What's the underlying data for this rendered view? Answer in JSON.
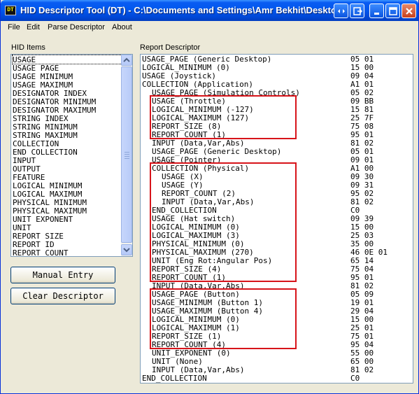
{
  "window": {
    "title": "HID Descriptor Tool (DT) - C:\\Documents and Settings\\Amr Bekhit\\Desktop",
    "icon_text": "DT"
  },
  "title_buttons": [
    "restore-icon",
    "extra-icon",
    "minimize-icon",
    "maximize-icon",
    "close-icon"
  ],
  "menu": [
    "File",
    "Edit",
    "Parse Descriptor",
    "About"
  ],
  "hid_items": {
    "label": "HID Items",
    "items": [
      "USAGE",
      "USAGE_PAGE",
      "USAGE_MINIMUM",
      "USAGE_MAXIMUM",
      "DESIGNATOR_INDEX",
      "DESIGNATOR_MINIMUM",
      "DESIGNATOR_MAXIMUM",
      "STRING_INDEX",
      "STRING_MINIMUM",
      "STRING_MAXIMUM",
      "COLLECTION",
      "END_COLLECTION",
      "INPUT",
      "OUTPUT",
      "FEATURE",
      "LOGICAL_MINIMUM",
      "LOGICAL_MAXIMUM",
      "PHYSICAL_MINIMUM",
      "PHYSICAL_MAXIMUM",
      "UNIT_EXPONENT",
      "UNIT",
      "REPORT_SIZE",
      "REPORT_ID",
      "REPORT_COUNT"
    ],
    "selected_index": 0
  },
  "buttons": {
    "manual_entry": "Manual Entry",
    "clear_descriptor": "Clear Descriptor"
  },
  "report": {
    "label": "Report Descriptor",
    "lines": [
      {
        "text": "USAGE_PAGE (Generic Desktop)",
        "indent": 0,
        "bytes": "05 01"
      },
      {
        "text": "LOGICAL_MINIMUM (0)",
        "indent": 0,
        "bytes": "15 00"
      },
      {
        "text": "USAGE (Joystick)",
        "indent": 0,
        "bytes": "09 04"
      },
      {
        "text": "COLLECTION (Application)",
        "indent": 0,
        "bytes": "A1 01"
      },
      {
        "text": "USAGE_PAGE (Simulation Controls)",
        "indent": 1,
        "bytes": "05 02"
      },
      {
        "text": "USAGE (Throttle)",
        "indent": 1,
        "bytes": "09 BB"
      },
      {
        "text": "LOGICAL_MINIMUM (-127)",
        "indent": 1,
        "bytes": "15 81"
      },
      {
        "text": "LOGICAL_MAXIMUM (127)",
        "indent": 1,
        "bytes": "25 7F"
      },
      {
        "text": "REPORT_SIZE (8)",
        "indent": 1,
        "bytes": "75 08"
      },
      {
        "text": "REPORT_COUNT (1)",
        "indent": 1,
        "bytes": "95 01"
      },
      {
        "text": "INPUT (Data,Var,Abs)",
        "indent": 1,
        "bytes": "81 02"
      },
      {
        "text": "USAGE_PAGE (Generic Desktop)",
        "indent": 1,
        "bytes": "05 01"
      },
      {
        "text": "USAGE (Pointer)",
        "indent": 1,
        "bytes": "09 01"
      },
      {
        "text": "COLLECTION (Physical)",
        "indent": 1,
        "bytes": "A1 00"
      },
      {
        "text": "USAGE (X)",
        "indent": 2,
        "bytes": "09 30"
      },
      {
        "text": "USAGE (Y)",
        "indent": 2,
        "bytes": "09 31"
      },
      {
        "text": "REPORT_COUNT (2)",
        "indent": 2,
        "bytes": "95 02"
      },
      {
        "text": "INPUT (Data,Var,Abs)",
        "indent": 2,
        "bytes": "81 02"
      },
      {
        "text": "END_COLLECTION",
        "indent": 1,
        "bytes": "C0"
      },
      {
        "text": "USAGE (Hat switch)",
        "indent": 1,
        "bytes": "09 39"
      },
      {
        "text": "LOGICAL_MINIMUM (0)",
        "indent": 1,
        "bytes": "15 00"
      },
      {
        "text": "LOGICAL_MAXIMUM (3)",
        "indent": 1,
        "bytes": "25 03"
      },
      {
        "text": "PHYSICAL_MINIMUM (0)",
        "indent": 1,
        "bytes": "35 00"
      },
      {
        "text": "PHYSICAL_MAXIMUM (270)",
        "indent": 1,
        "bytes": "46 0E 01"
      },
      {
        "text": "UNIT (Eng Rot:Angular Pos)",
        "indent": 1,
        "bytes": "65 14"
      },
      {
        "text": "REPORT_SIZE (4)",
        "indent": 1,
        "bytes": "75 04"
      },
      {
        "text": "REPORT_COUNT (1)",
        "indent": 1,
        "bytes": "95 01"
      },
      {
        "text": "INPUT (Data,Var,Abs)",
        "indent": 1,
        "bytes": "81 02"
      },
      {
        "text": "USAGE_PAGE (Button)",
        "indent": 1,
        "bytes": "05 09"
      },
      {
        "text": "USAGE_MINIMUM (Button 1)",
        "indent": 1,
        "bytes": "19 01"
      },
      {
        "text": "USAGE_MAXIMUM (Button 4)",
        "indent": 1,
        "bytes": "29 04"
      },
      {
        "text": "LOGICAL_MINIMUM (0)",
        "indent": 1,
        "bytes": "15 00"
      },
      {
        "text": "LOGICAL_MAXIMUM (1)",
        "indent": 1,
        "bytes": "25 01"
      },
      {
        "text": "REPORT_SIZE (1)",
        "indent": 1,
        "bytes": "75 01"
      },
      {
        "text": "REPORT_COUNT (4)",
        "indent": 1,
        "bytes": "95 04"
      },
      {
        "text": "UNIT_EXPONENT (0)",
        "indent": 1,
        "bytes": "55 00"
      },
      {
        "text": "UNIT (None)",
        "indent": 1,
        "bytes": "65 00"
      },
      {
        "text": "INPUT (Data,Var,Abs)",
        "indent": 1,
        "bytes": "81 02"
      },
      {
        "text": "END_COLLECTION",
        "indent": 0,
        "bytes": "C0"
      }
    ],
    "highlight_groups": [
      {
        "first_line": 5,
        "last_line": 9
      },
      {
        "first_line": 13,
        "last_line": 26
      },
      {
        "first_line": 28,
        "last_line": 34
      }
    ]
  },
  "colors": {
    "titlebar": "#0058ee",
    "highlight": "#d7141a",
    "window_bg": "#ece9d8"
  }
}
